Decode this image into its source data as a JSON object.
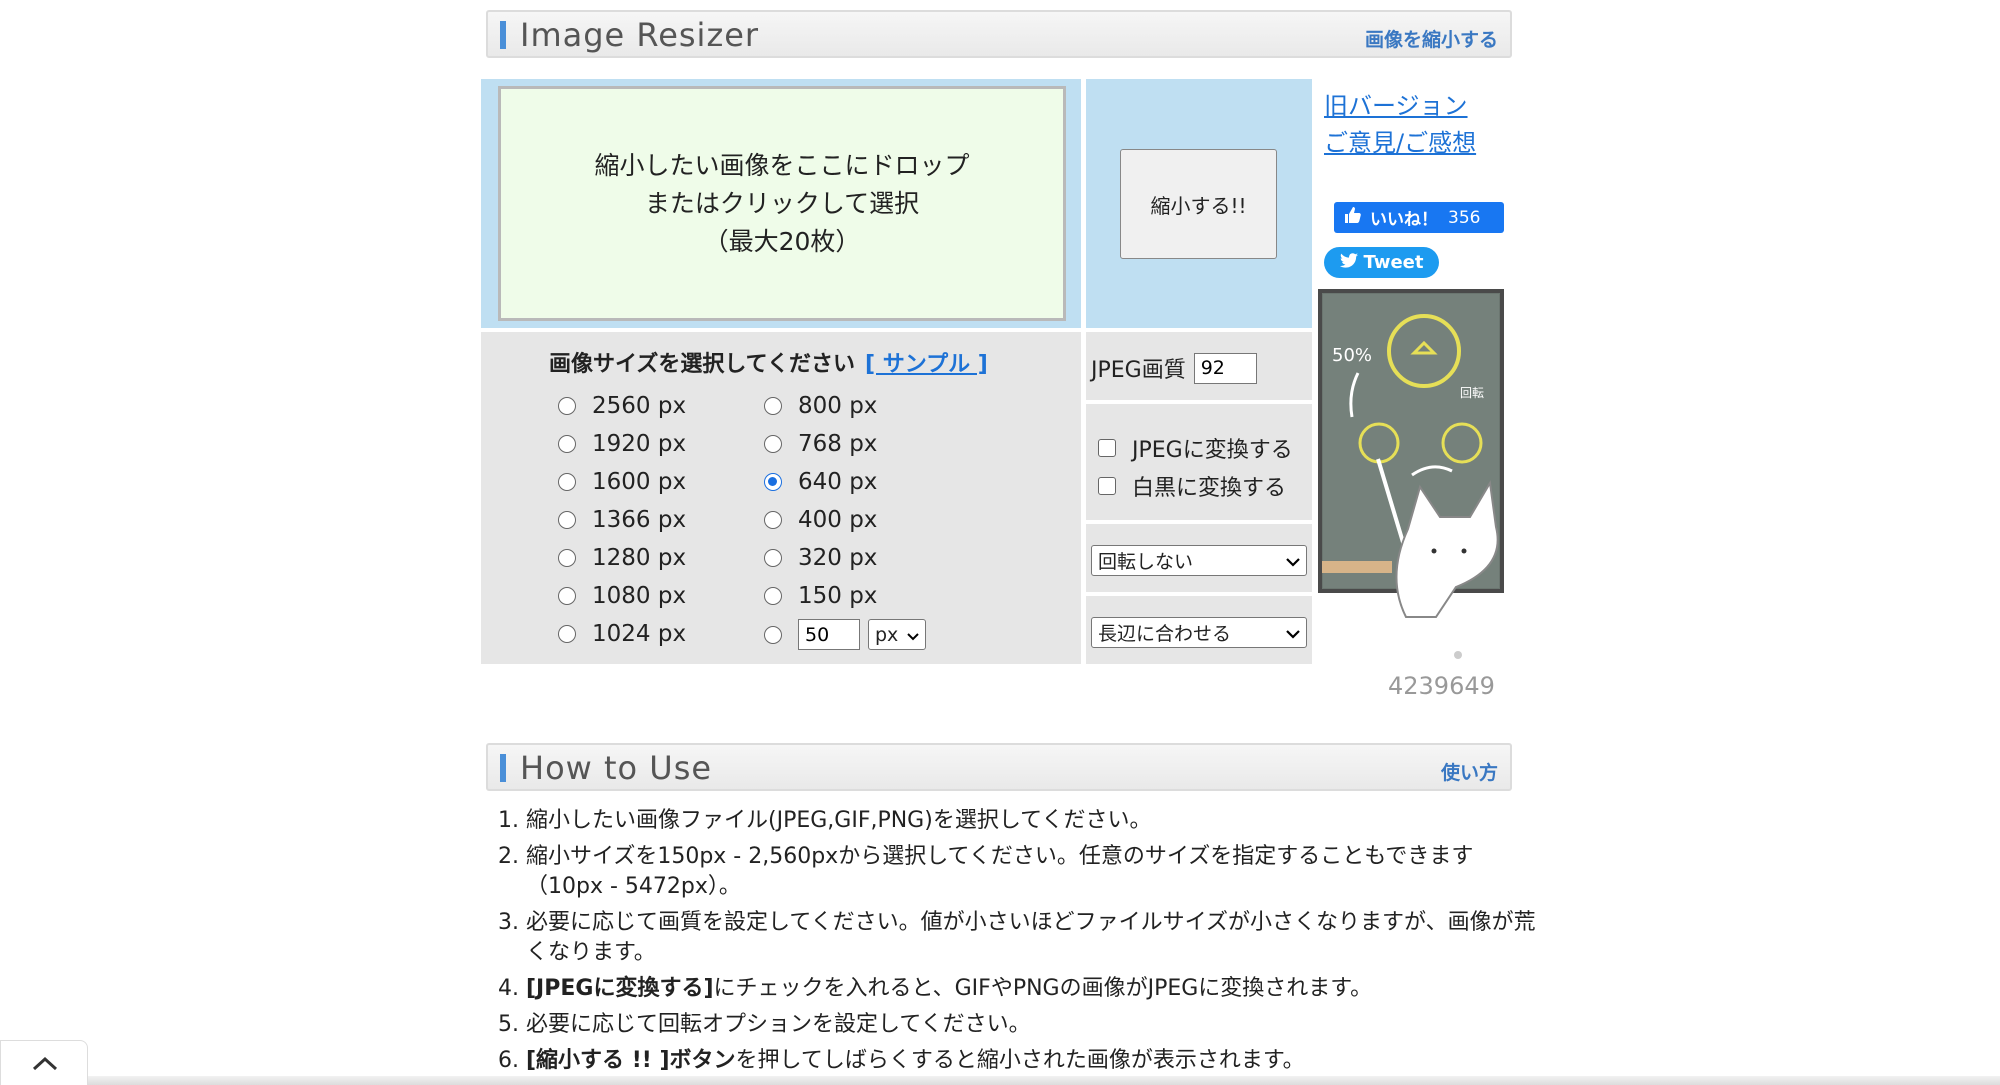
{
  "header1": {
    "title": "Image Resizer",
    "subtitle": "画像を縮小する"
  },
  "drop": {
    "line1": "縮小したい画像をここにドロップ",
    "line2": "またはクリックして選択",
    "line3": "（最大20枚）"
  },
  "resize_button": "縮小する!!",
  "links": {
    "old_version": "旧バージョン",
    "feedback": "ご意見/ご感想"
  },
  "social": {
    "like_label": "いいね！",
    "like_count": "356",
    "tweet_label": "Tweet"
  },
  "counter": "4239649",
  "sizes": {
    "title": "画像サイズを選択してください",
    "sample_link": "[ サンプル ]",
    "col1": [
      "2560 px",
      "1920 px",
      "1600 px",
      "1366 px",
      "1280 px",
      "1080 px",
      "1024 px"
    ],
    "col2": [
      "800 px",
      "768 px",
      "640 px",
      "400 px",
      "320 px",
      "150 px"
    ],
    "selected": "640 px",
    "custom_value": "50",
    "custom_unit": "px"
  },
  "options": {
    "jpeg_quality_label": "JPEG画質",
    "jpeg_quality_value": "92",
    "convert_jpeg_label": "JPEGに変換する",
    "grayscale_label": "白黒に変換する",
    "rotate_selected": "回転しない",
    "fit_selected": "長辺に合わせる"
  },
  "header2": {
    "title": "How to Use",
    "subtitle": "使い方"
  },
  "howto": [
    {
      "n": "1.",
      "text": "縮小したい画像ファイル(JPEG,GIF,PNG)を選択してください。"
    },
    {
      "n": "2.",
      "text": "縮小サイズを150px - 2,560pxから選択してください。任意のサイズを指定することもできます（10px - 5472px）。"
    },
    {
      "n": "3.",
      "text": "必要に応じて画質を設定してください。値が小さいほどファイルサイズが小さくなりますが、画像が荒くなります。"
    },
    {
      "n": "4.",
      "bold": "[JPEGに変換する]",
      "text": "にチェックを入れると、GIFやPNGの画像がJPEGに変換されます。"
    },
    {
      "n": "5.",
      "text": "必要に応じて回転オプションを設定してください。"
    },
    {
      "n": "6.",
      "bold": "[縮小する !! ]ボタン",
      "text": "を押してしばらくすると縮小された画像が表示されます。"
    }
  ],
  "illustration": {
    "label_percent": "50%",
    "label_rotate": "回転"
  },
  "colors": {
    "accent": "#1d72d6",
    "drop_bg": "#effce9",
    "panel_blue": "#bfdff2",
    "panel_gray": "#e6e6e6"
  }
}
